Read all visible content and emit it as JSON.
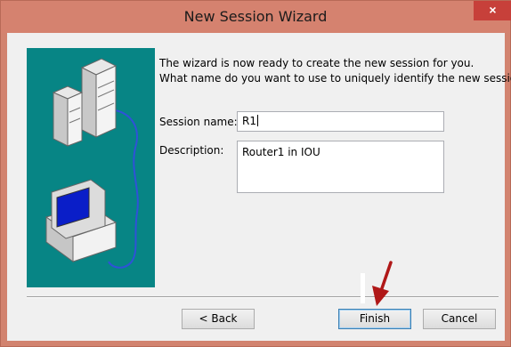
{
  "window": {
    "title": "New Session Wizard",
    "close_glyph": "×"
  },
  "intro": {
    "line1": "The wizard is now ready to create the new session for you.",
    "line2": "What name do you want to use to uniquely identify the new session?"
  },
  "form": {
    "session_name_label": "Session name:",
    "session_name_value": "R1",
    "description_label": "Description:",
    "description_value": "Router1 in IOU"
  },
  "buttons": {
    "back": "< Back",
    "finish": "Finish",
    "cancel": "Cancel"
  },
  "colors": {
    "title_bar": "#d5826f",
    "close": "#c7403a",
    "art_bg": "#078585",
    "arrow": "#b01818"
  },
  "icons": {
    "server": "server-icon",
    "computer": "computer-icon",
    "arrow": "arrow-annotation-icon"
  }
}
